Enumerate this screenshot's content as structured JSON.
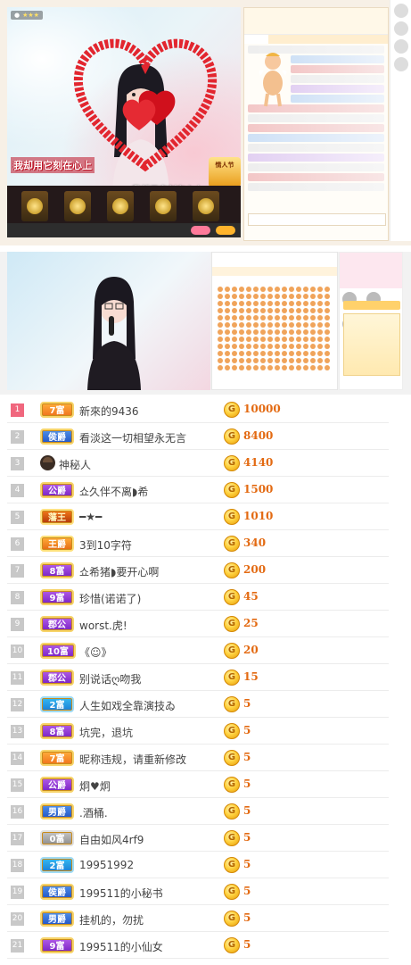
{
  "shot1": {
    "caption_left": "我却用它刻在心上",
    "caption_right": "我却用它刻在心上",
    "gift_badge": "情人节"
  },
  "colors": {
    "rank_top": "#f0677e",
    "score": "#e36a12",
    "coin": "#ffd23f"
  },
  "leaderboard": [
    {
      "rank": "1",
      "badge": "7富",
      "badge_style": "orange",
      "name": "新來的9436",
      "coin": "G",
      "score": "10000"
    },
    {
      "rank": "2",
      "badge": "侯爵",
      "badge_style": "blue",
      "name": "看淡这一切相望永无言",
      "coin": "G",
      "score": "8400"
    },
    {
      "rank": "3",
      "badge": "",
      "badge_style": "mystery",
      "name": "神秘人",
      "coin": "G",
      "score": "4140"
    },
    {
      "rank": "4",
      "badge": "公爵",
      "badge_style": "purple",
      "name": "쇼久伴不离◗希",
      "coin": "G",
      "score": "1500"
    },
    {
      "rank": "5",
      "badge": "藩王",
      "badge_style": "emperor",
      "name": "━★━",
      "coin": "G",
      "score": "1010"
    },
    {
      "rank": "6",
      "badge": "王爵",
      "badge_style": "wang",
      "name": "3到10字符",
      "coin": "G",
      "score": "340"
    },
    {
      "rank": "7",
      "badge": "8富",
      "badge_style": "purple",
      "name": "쇼希猪◗要开心啊",
      "coin": "G",
      "score": "200"
    },
    {
      "rank": "8",
      "badge": "9富",
      "badge_style": "purple",
      "name": "珍惜(诺诺了)",
      "coin": "G",
      "score": "45"
    },
    {
      "rank": "9",
      "badge": "郡公",
      "badge_style": "purple",
      "name": "worst.虎!",
      "coin": "G",
      "score": "25"
    },
    {
      "rank": "10",
      "badge": "10富",
      "badge_style": "purple",
      "name": "《☺》",
      "coin": "G",
      "score": "20"
    },
    {
      "rank": "11",
      "badge": "郡公",
      "badge_style": "purple",
      "name": "别说话ღ吻我",
      "coin": "G",
      "score": "15"
    },
    {
      "rank": "12",
      "badge": "2富",
      "badge_style": "cyan",
      "name": "人生如戏全靠演技ゐ",
      "coin": "G",
      "score": "5"
    },
    {
      "rank": "13",
      "badge": "8富",
      "badge_style": "purple",
      "name": "坑完，退坑",
      "coin": "G",
      "score": "5"
    },
    {
      "rank": "14",
      "badge": "7富",
      "badge_style": "orange",
      "name": "昵称违规，请重新修改",
      "coin": "G",
      "score": "5"
    },
    {
      "rank": "15",
      "badge": "公爵",
      "badge_style": "purple",
      "name": "炯♥炯",
      "coin": "G",
      "score": "5"
    },
    {
      "rank": "16",
      "badge": "男爵",
      "badge_style": "blue",
      "name": ".酒桶.",
      "coin": "G",
      "score": "5"
    },
    {
      "rank": "17",
      "badge": "0富",
      "badge_style": "gray",
      "name": "自由如风4rf9",
      "coin": "G",
      "score": "5"
    },
    {
      "rank": "18",
      "badge": "2富",
      "badge_style": "cyan",
      "name": "19951992",
      "coin": "G",
      "score": "5"
    },
    {
      "rank": "19",
      "badge": "侯爵",
      "badge_style": "blue",
      "name": "199511的小秘书",
      "coin": "G",
      "score": "5"
    },
    {
      "rank": "20",
      "badge": "男爵",
      "badge_style": "blue",
      "name": "挂机的，勿扰",
      "coin": "G",
      "score": "5"
    },
    {
      "rank": "21",
      "badge": "9富",
      "badge_style": "purple",
      "name": "199511的小仙女",
      "coin": "G",
      "score": "5"
    }
  ]
}
